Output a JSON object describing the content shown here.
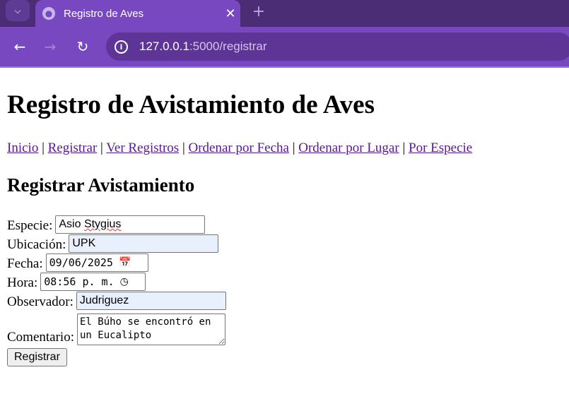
{
  "browser": {
    "tab_title": "Registro de Aves",
    "new_tab_label": "+",
    "url_host": "127.0.0.1",
    "url_rest": ":5000/registrar"
  },
  "page": {
    "title": "Registro de Avistamiento de Aves",
    "nav": [
      "Inicio",
      "Registrar",
      "Ver Registros",
      "Ordenar por Fecha",
      "Ordenar por Lugar",
      "Por Especie"
    ],
    "nav_separator": "|",
    "section_title": "Registrar Avistamiento"
  },
  "form": {
    "especie_label": "Especie:",
    "especie_value_first": "Asio",
    "especie_value_second": "Stygius",
    "ubicacion_label": "Ubicación:",
    "ubicacion_value": "UPK",
    "fecha_label": "Fecha:",
    "fecha_value": "09/06/2025",
    "hora_label": "Hora:",
    "hora_value": "08:56 p. m.",
    "observador_label": "Observador:",
    "observador_value": "Judriguez",
    "comentario_label": "Comentario:",
    "comentario_value": "El Búho se encontró en un Eucalipto",
    "submit_label": "Registrar"
  },
  "icons": {
    "dropdown": "chevron-down-icon",
    "site": "globe-icon",
    "close": "close-icon",
    "back": "back-arrow-icon",
    "forward": "forward-arrow-icon",
    "reload": "reload-icon",
    "info": "info-icon",
    "calendar": "calendar-icon",
    "clock": "clock-icon"
  },
  "colors": {
    "tabbar": "#4a2d75",
    "toolbar": "#7848c0",
    "link": "#551a8b",
    "autofill": "#e8f0fe"
  }
}
